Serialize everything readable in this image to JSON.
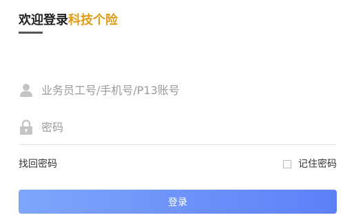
{
  "header": {
    "title_prefix": "欢迎登录",
    "title_accent": "科技个险",
    "accent_color": "#e29a12"
  },
  "form": {
    "username": {
      "icon": "user-icon",
      "value": "",
      "placeholder": "业务员工号/手机号/P13账号"
    },
    "password": {
      "icon": "lock-icon",
      "value": "",
      "placeholder": "密码"
    },
    "forgot_password_label": "找回密码",
    "remember": {
      "label": "记住密码",
      "checked": false
    },
    "login_button_label": "登录",
    "button_color": "#6b8ff9"
  }
}
